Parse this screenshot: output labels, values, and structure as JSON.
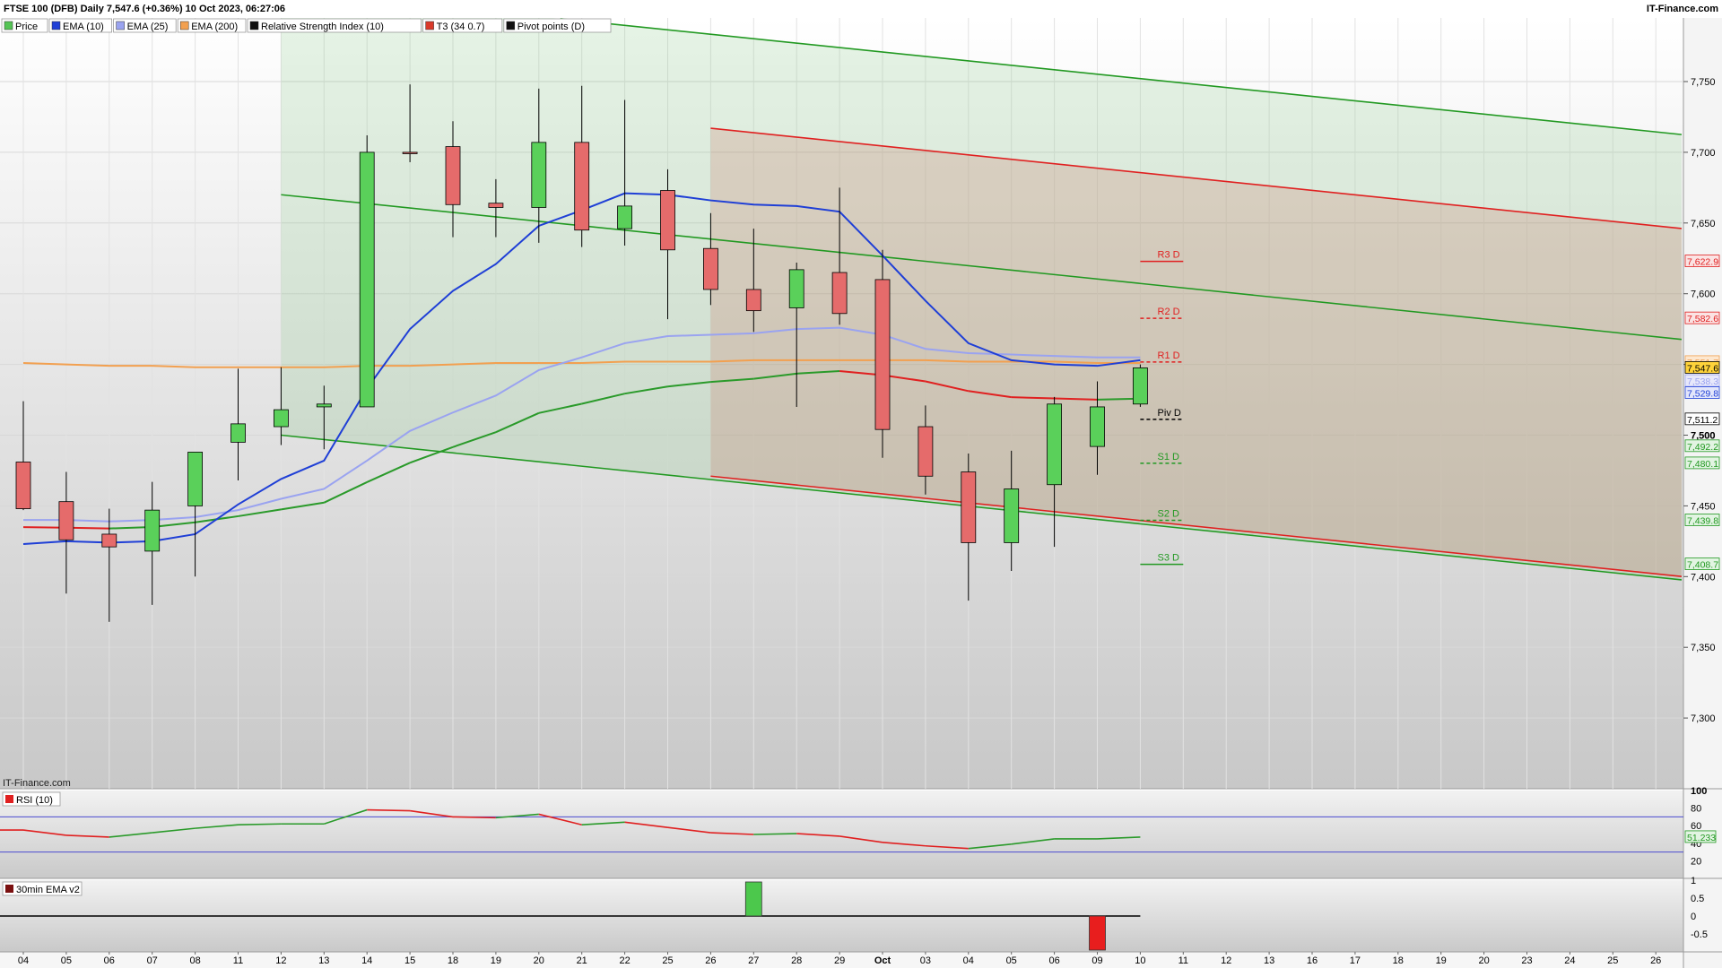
{
  "header": {
    "title": "FTSE 100 (DFB) Daily 7,547.6 (+0.36%) 10 Oct 2023, 06:27:06",
    "brand": "IT-Finance.com",
    "watermark": "IT-Finance.com"
  },
  "legend": [
    {
      "label": "Price",
      "color": "#55c455"
    },
    {
      "label": "EMA (10)",
      "color": "#1f3fd6"
    },
    {
      "label": "EMA (25)",
      "color": "#9aa3f0"
    },
    {
      "label": "EMA (200)",
      "color": "#f2a050"
    },
    {
      "label": "Relative Strength Index (10)",
      "color": "#111111"
    },
    {
      "label": "T3 (34 0.7)",
      "color": "#d93a2a"
    },
    {
      "label": "Pivot points (D)",
      "color": "#111111"
    }
  ],
  "chart_data": [
    {
      "type": "candlestick",
      "title": "FTSE 100 (DFB) Daily",
      "x": [
        "04",
        "05",
        "06",
        "07",
        "08",
        "11",
        "12",
        "13",
        "14",
        "15",
        "18",
        "19",
        "20",
        "21",
        "22",
        "25",
        "26",
        "27",
        "28",
        "29",
        "Oct",
        "03",
        "04",
        "05",
        "06",
        "09",
        "10",
        "11",
        "12",
        "13",
        "16",
        "17",
        "18",
        "19",
        "20",
        "23",
        "24",
        "25",
        "26"
      ],
      "ylim": [
        7250,
        7795
      ],
      "yticks": [
        7300,
        7350,
        7400,
        7450,
        7500,
        7550,
        7600,
        7650,
        7700,
        7750
      ],
      "ytick_labels": [
        "7,300",
        "7,350",
        "7,400",
        "7,450",
        "7,500",
        "7,550",
        "7,600",
        "7,650",
        "7,700",
        "7,750"
      ],
      "candles": [
        {
          "o": 7481,
          "h": 7524,
          "l": 7447,
          "c": 7448
        },
        {
          "o": 7453,
          "h": 7474,
          "l": 7388,
          "c": 7426
        },
        {
          "o": 7430,
          "h": 7448,
          "l": 7368,
          "c": 7421
        },
        {
          "o": 7418,
          "h": 7467,
          "l": 7380,
          "c": 7447
        },
        {
          "o": 7450,
          "h": 7485,
          "l": 7400,
          "c": 7488
        },
        {
          "o": 7495,
          "h": 7547,
          "l": 7468,
          "c": 7508
        },
        {
          "o": 7506,
          "h": 7548,
          "l": 7493,
          "c": 7518
        },
        {
          "o": 7520,
          "h": 7535,
          "l": 7490,
          "c": 7522
        },
        {
          "o": 7520,
          "h": 7712,
          "l": 7520,
          "c": 7700
        },
        {
          "o": 7700,
          "h": 7748,
          "l": 7693,
          "c": 7699
        },
        {
          "o": 7704,
          "h": 7722,
          "l": 7640,
          "c": 7663
        },
        {
          "o": 7664,
          "h": 7681,
          "l": 7640,
          "c": 7661
        },
        {
          "o": 7661,
          "h": 7745,
          "l": 7636,
          "c": 7707
        },
        {
          "o": 7707,
          "h": 7747,
          "l": 7633,
          "c": 7645
        },
        {
          "o": 7646,
          "h": 7737,
          "l": 7634,
          "c": 7662
        },
        {
          "o": 7673,
          "h": 7688,
          "l": 7582,
          "c": 7631
        },
        {
          "o": 7632,
          "h": 7657,
          "l": 7592,
          "c": 7603
        },
        {
          "o": 7603,
          "h": 7646,
          "l": 7573,
          "c": 7588
        },
        {
          "o": 7590,
          "h": 7622,
          "l": 7520,
          "c": 7617
        },
        {
          "o": 7615,
          "h": 7675,
          "l": 7578,
          "c": 7586
        },
        {
          "o": 7610,
          "h": 7631,
          "l": 7484,
          "c": 7504
        },
        {
          "o": 7506,
          "h": 7521,
          "l": 7458,
          "c": 7471
        },
        {
          "o": 7474,
          "h": 7487,
          "l": 7383,
          "c": 7424
        },
        {
          "o": 7424,
          "h": 7489,
          "l": 7404,
          "c": 7462
        },
        {
          "o": 7465,
          "h": 7527,
          "l": 7421,
          "c": 7522
        },
        {
          "o": 7492,
          "h": 7538,
          "l": 7472,
          "c": 7520
        },
        {
          "o": 7522,
          "h": 7550,
          "l": 7520,
          "c": 7547.6
        }
      ],
      "ema10": [
        7423,
        7425,
        7424,
        7425,
        7430,
        7451,
        7469,
        7482,
        7533,
        7575,
        7602,
        7621,
        7648,
        7659,
        7671,
        7670,
        7666,
        7663,
        7662,
        7658,
        7627,
        7595,
        7565,
        7553,
        7550,
        7549,
        7553
      ],
      "ema25": [
        7440,
        7440,
        7439,
        7440,
        7442,
        7447,
        7455,
        7462,
        7482,
        7503,
        7516,
        7528,
        7546,
        7555,
        7565,
        7570,
        7571,
        7572,
        7575,
        7576,
        7571,
        7561,
        7558,
        7557,
        7556,
        7555,
        7555
      ],
      "ema200": [
        7551,
        7550,
        7549,
        7549,
        7548,
        7548,
        7548,
        7548,
        7549,
        7549,
        7550,
        7551,
        7551,
        7551,
        7552,
        7552,
        7552,
        7553,
        7553,
        7553,
        7553,
        7553,
        7552,
        7552,
        7552,
        7551,
        7551
      ],
      "pivot_levels": [
        {
          "label": "R3 D",
          "value": 7622.9
        },
        {
          "label": "R2 D",
          "value": 7582.6
        },
        {
          "label": "R1 D",
          "value": 7551.7
        },
        {
          "label": "Piv D",
          "value": 7511.2
        },
        {
          "label": "S1 D",
          "value": 7480.1
        },
        {
          "label": "S2 D",
          "value": 7439.8
        },
        {
          "label": "S3 D",
          "value": 7408.7
        }
      ],
      "price_tags": [
        "7,622.9",
        "7,582.6",
        "7,551.7",
        "7,547.6",
        "7,538.3",
        "7,529.8",
        "7,511.2",
        "7,500",
        "7,492.2",
        "7,480.1",
        "7,439.8",
        "7,408.7"
      ]
    },
    {
      "type": "line",
      "title": "RSI (10)",
      "ylim": [
        0,
        100
      ],
      "yticks": [
        20,
        40,
        60,
        80,
        100
      ],
      "ytick_labels": [
        "20",
        "40",
        "60",
        "80",
        "100"
      ],
      "values": [
        55,
        49,
        47,
        52,
        57,
        61,
        62,
        62,
        78,
        77,
        70,
        69,
        73,
        61,
        64,
        58,
        52,
        50,
        51,
        48,
        41,
        37,
        34,
        39,
        45,
        45,
        47
      ],
      "last": "51.233"
    },
    {
      "type": "bar",
      "title": "30min EMA v2",
      "ylim": [
        -1,
        1
      ],
      "yticks": [
        -0.5,
        0,
        0.5,
        1
      ],
      "ytick_labels": [
        "-0.5",
        "0",
        "0.5",
        "1"
      ],
      "bars": [
        {
          "x": "27",
          "value": 0.95
        },
        {
          "x": "09",
          "value": -0.95
        }
      ]
    }
  ]
}
